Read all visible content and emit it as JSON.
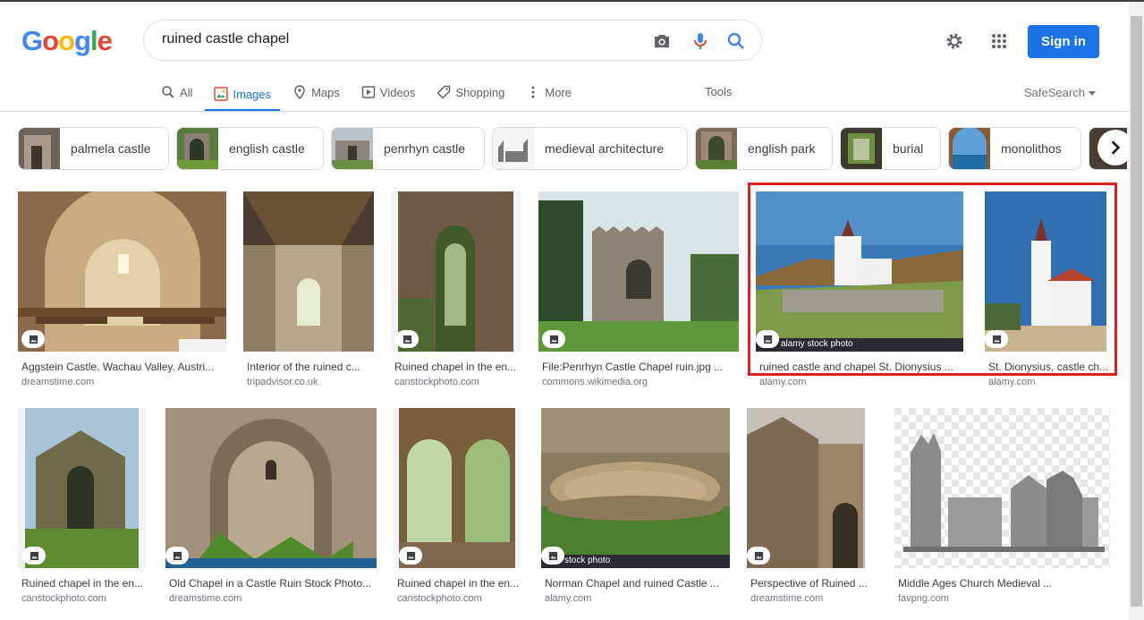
{
  "logo": {
    "letters": [
      "G",
      "o",
      "o",
      "g",
      "l",
      "e"
    ],
    "colors": [
      "#4285f4",
      "#ea4335",
      "#fbbc05",
      "#4285f4",
      "#34a853",
      "#ea4335"
    ]
  },
  "search": {
    "query": "ruined castle chapel"
  },
  "header": {
    "signin_label": "Sign in"
  },
  "tabs": [
    {
      "label": "All",
      "icon": "search-icon"
    },
    {
      "label": "Images",
      "icon": "image-icon",
      "active": true
    },
    {
      "label": "Maps",
      "icon": "map-pin-icon"
    },
    {
      "label": "Videos",
      "icon": "play-icon"
    },
    {
      "label": "Shopping",
      "icon": "tag-icon"
    },
    {
      "label": "More",
      "icon": "more-vert-icon"
    }
  ],
  "tools_label": "Tools",
  "safesearch_label": "SafeSearch",
  "chips": [
    {
      "label": "palmela castle"
    },
    {
      "label": "english castle"
    },
    {
      "label": "penrhyn castle"
    },
    {
      "label": "medieval architecture"
    },
    {
      "label": "english park"
    },
    {
      "label": "burial"
    },
    {
      "label": "monolithos"
    }
  ],
  "results": [
    {
      "title": "Aggstein Castle. Wachau Valley. Austri...",
      "source": "dreamstime.com",
      "selected": false
    },
    {
      "title": "Interior of the ruined c...",
      "source": "tripadvisor.co.uk",
      "selected": false
    },
    {
      "title": "Ruined chapel in the en...",
      "source": "canstockphoto.com",
      "selected": false
    },
    {
      "title": "File:Penrhyn Castle Chapel ruin.jpg ...",
      "source": "commons.wikimedia.org",
      "selected": false
    },
    {
      "title": "ruined castle and chapel St. Dionysius ...",
      "source": "alamy.com",
      "selected": true,
      "overlay": "alamy stock photo"
    },
    {
      "title": "St. Dionysius, castle ch...",
      "source": "alamy.com",
      "selected": true
    },
    {
      "title": "Ruined chapel in the en...",
      "source": "canstockphoto.com",
      "selected": false
    },
    {
      "title": "Old Chapel in a Castle Ruin Stock Photo...",
      "source": "dreamstime.com",
      "selected": false
    },
    {
      "title": "Ruined chapel in the en...",
      "source": "canstockphoto.com",
      "selected": false
    },
    {
      "title": "Norman Chapel and ruined Castle ...",
      "source": "alamy.com",
      "selected": false,
      "overlay": "stock photo"
    },
    {
      "title": "Perspective of Ruined ...",
      "source": "dreamstime.com",
      "selected": false
    },
    {
      "title": "Middle Ages Church Medieval ...",
      "source": "favpng.com",
      "selected": false
    }
  ],
  "colors": {
    "accent": "#1a73e8",
    "highlight": "#e0201f"
  }
}
